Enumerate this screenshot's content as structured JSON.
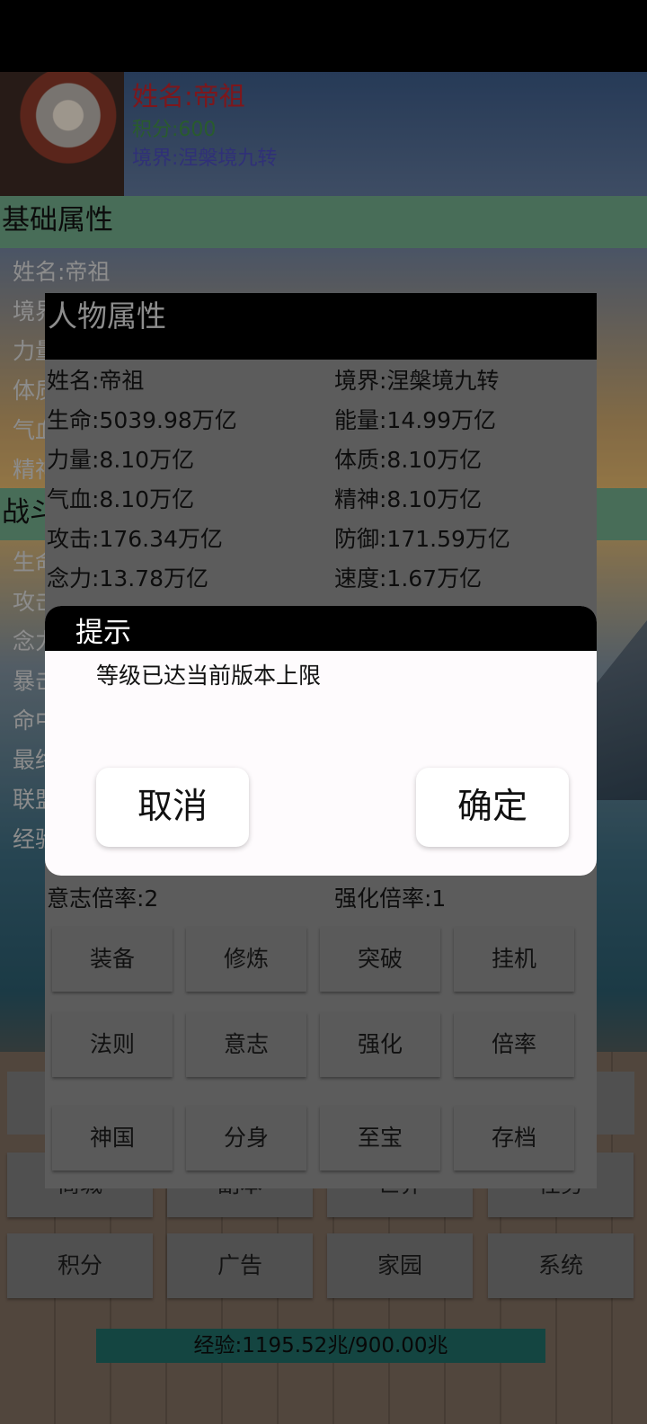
{
  "header": {
    "name": "姓名:帝祖",
    "score": "积分:600",
    "realm": "境界:涅槃境九转"
  },
  "basic_section": {
    "title": "基础属性",
    "visible_items": [
      "姓名:帝祖",
      "境界",
      "力量",
      "体质",
      "气血",
      "精神"
    ]
  },
  "battle_section": {
    "title": "战斗",
    "visible_items": [
      "生命",
      "攻击",
      "念力",
      "暴击",
      "命中",
      "最终",
      "联盟",
      "经验"
    ]
  },
  "attr_panel": {
    "title": "人物属性",
    "rows": [
      {
        "left": "姓名:帝祖",
        "right": "境界:涅槃境九转"
      },
      {
        "left": "生命:5039.98万亿",
        "right": "能量:14.99万亿"
      },
      {
        "left": "力量:8.10万亿",
        "right": "体质:8.10万亿"
      },
      {
        "left": "气血:8.10万亿",
        "right": "精神:8.10万亿"
      },
      {
        "left": "攻击:176.34万亿",
        "right": "防御:171.59万亿"
      },
      {
        "left": "念力:13.78万亿",
        "right": "速度:1.67万亿"
      }
    ],
    "bottom_row": {
      "left": "意志倍率:2",
      "right": "强化倍率:1"
    },
    "buttons": [
      "装备",
      "修炼",
      "突破",
      "挂机",
      "法则",
      "意志",
      "强化",
      "倍率",
      "神国",
      "分身",
      "至宝",
      "存档"
    ]
  },
  "bottom_tabs": {
    "row2": [
      "商城",
      "副本",
      "世界",
      "任务"
    ],
    "row3": [
      "积分",
      "广告",
      "家园",
      "系统"
    ]
  },
  "dialog": {
    "title": "提示",
    "message": "等级已达当前版本上限",
    "cancel": "取消",
    "confirm": "确定"
  },
  "exp_bar": {
    "text": "经验:1195.52兆/900.00兆"
  }
}
